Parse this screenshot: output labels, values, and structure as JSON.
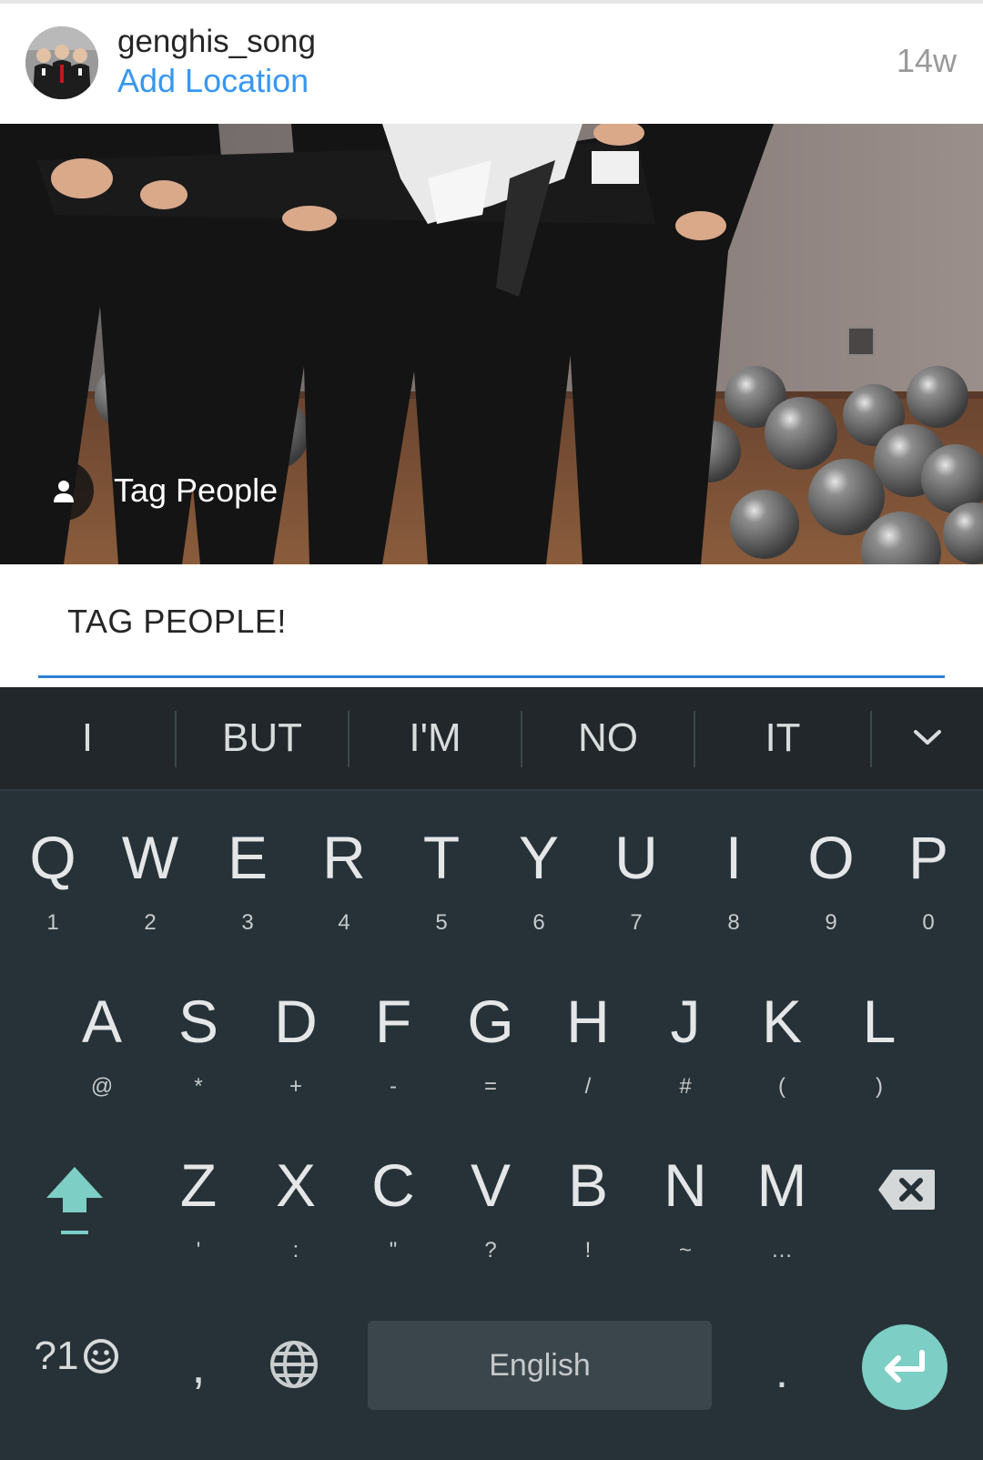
{
  "post": {
    "username": "genghis_song",
    "location_link": "Add Location",
    "time_ago": "14w"
  },
  "photo": {
    "tag_people_label": "Tag People"
  },
  "caption": {
    "value": "TAG PEOPLE!"
  },
  "keyboard": {
    "suggestions": [
      "I",
      "BUT",
      "I'M",
      "NO",
      "IT"
    ],
    "row1": [
      {
        "key": "Q",
        "sub": "1"
      },
      {
        "key": "W",
        "sub": "2"
      },
      {
        "key": "E",
        "sub": "3"
      },
      {
        "key": "R",
        "sub": "4"
      },
      {
        "key": "T",
        "sub": "5"
      },
      {
        "key": "Y",
        "sub": "6"
      },
      {
        "key": "U",
        "sub": "7"
      },
      {
        "key": "I",
        "sub": "8"
      },
      {
        "key": "O",
        "sub": "9"
      },
      {
        "key": "P",
        "sub": "0"
      }
    ],
    "row2": [
      {
        "key": "A",
        "sub": "@"
      },
      {
        "key": "S",
        "sub": "*"
      },
      {
        "key": "D",
        "sub": "+"
      },
      {
        "key": "F",
        "sub": "-"
      },
      {
        "key": "G",
        "sub": "="
      },
      {
        "key": "H",
        "sub": "/"
      },
      {
        "key": "J",
        "sub": "#"
      },
      {
        "key": "K",
        "sub": "("
      },
      {
        "key": "L",
        "sub": ")"
      }
    ],
    "row3": [
      {
        "key": "Z",
        "sub": "'"
      },
      {
        "key": "X",
        "sub": ":"
      },
      {
        "key": "C",
        "sub": "\""
      },
      {
        "key": "V",
        "sub": "?"
      },
      {
        "key": "B",
        "sub": "!"
      },
      {
        "key": "N",
        "sub": "~"
      },
      {
        "key": "M",
        "sub": "…"
      }
    ],
    "symbols_label": "?1",
    "comma": ",",
    "space_label": "English",
    "period": "."
  },
  "colors": {
    "link_blue": "#3897f0",
    "keyboard_bg": "#263238",
    "accent_teal": "#7dcec4"
  }
}
